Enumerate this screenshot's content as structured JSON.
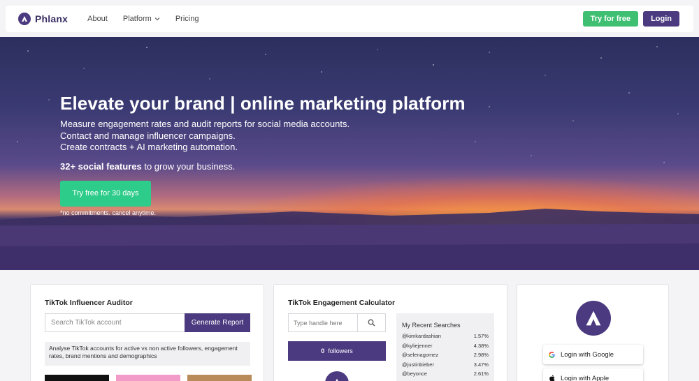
{
  "header": {
    "logo_text": "Phlanx",
    "nav": [
      {
        "label": "About"
      },
      {
        "label": "Platform"
      },
      {
        "label": "Pricing"
      }
    ],
    "try_free_label": "Try for free",
    "login_label": "Login"
  },
  "hero": {
    "title": "Elevate your brand | online marketing platform",
    "lines": [
      "Measure engagement rates and audit reports for social media accounts.",
      "Contact and manage influencer campaigns.",
      "Create contracts + AI marketing automation."
    ],
    "features_bold": "32+ social features",
    "features_rest": " to grow your business.",
    "cta_label": "Try free for 30 days",
    "note": "*no commitments. cancel anytime."
  },
  "auditor": {
    "title": "TikTok Influencer Auditor",
    "search_placeholder": "Search TikTok account",
    "button_label": "Generate Report",
    "description": "Analyse TikTok accounts for active vs non active followers, engagement rates, brand mentions and demographics"
  },
  "calculator": {
    "title": "TikTok Engagement Calculator",
    "handle_placeholder": "Type handle here",
    "followers_count": "0",
    "followers_label": "followers",
    "recent_title": "My Recent Searches",
    "recent": [
      {
        "handle": "@kimkardashian",
        "rate": "1.57%"
      },
      {
        "handle": "@kyliejenner",
        "rate": "4.38%"
      },
      {
        "handle": "@selenagomez",
        "rate": "2.98%"
      },
      {
        "handle": "@justinbieber",
        "rate": "3.47%"
      },
      {
        "handle": "@beyonce",
        "rate": "2.61%"
      }
    ]
  },
  "login_card": {
    "google_label": "Login with Google",
    "apple_label": "Login with Apple"
  },
  "colors": {
    "brand_purple": "#4b3a80",
    "green": "#3fbf72",
    "hero_cta_green": "#2ecc8a"
  }
}
